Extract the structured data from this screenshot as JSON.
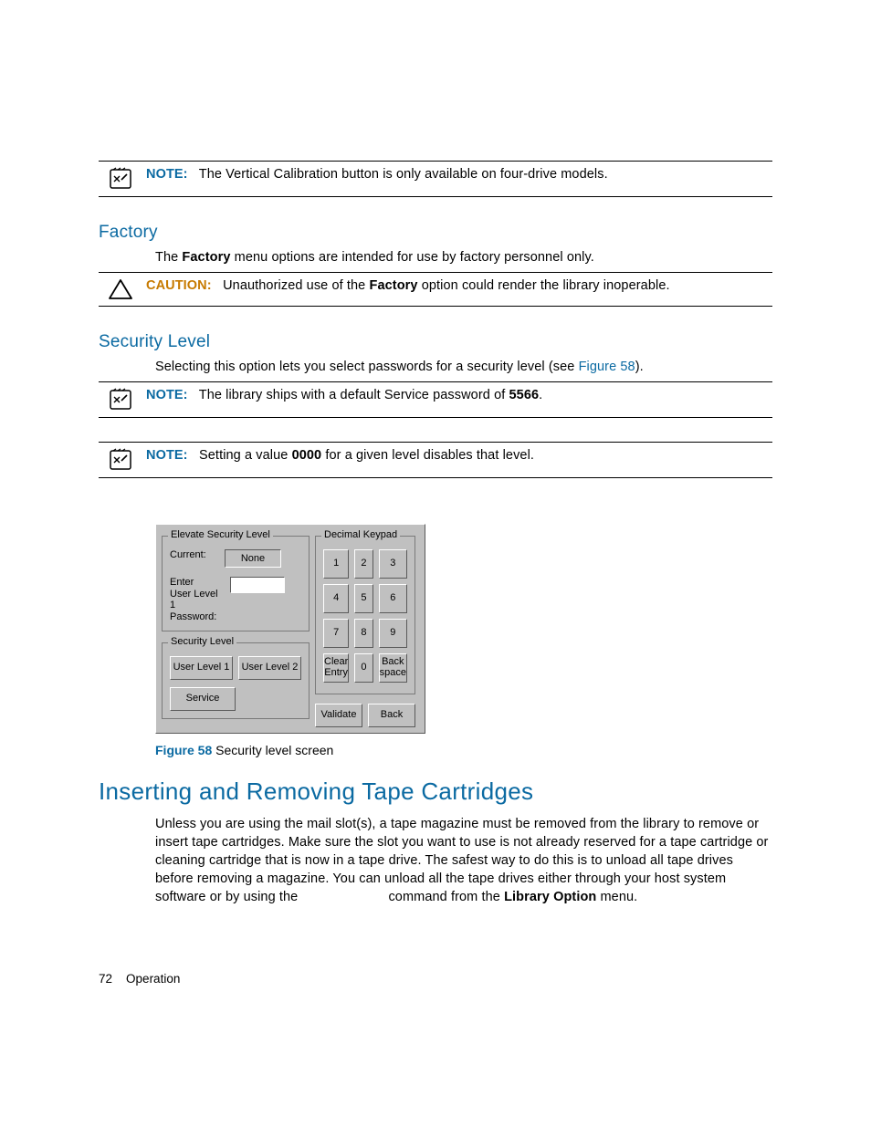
{
  "notes": {
    "n1": {
      "label": "NOTE:",
      "pre": "The Vertical Calibration button is only available on four-drive models.",
      "post": ""
    },
    "n2": {
      "label": "NOTE:",
      "pre": "The library ships with a default Service password of ",
      "bold": "5566",
      "post": "."
    },
    "n3": {
      "label": "NOTE:",
      "pre": "Setting a value ",
      "bold": "0000",
      "post": " for a given level disables that level."
    }
  },
  "caution": {
    "label": "CAUTION:",
    "pre": "Unauthorized use of the ",
    "bold": "Factory",
    "post": " option could render the library inoperable."
  },
  "headings": {
    "factory": "Factory",
    "security": "Security Level",
    "cartridges": "Inserting and Removing Tape Cartridges"
  },
  "body": {
    "factory_pre": "The ",
    "factory_bold": "Factory",
    "factory_post": " menu options are intended for use by factory personnel only.",
    "security_pre": "Selecting this option lets you select passwords for a security level (see ",
    "security_link": "Figure 58",
    "security_post": ").",
    "cart": "Unless you are using the mail slot(s), a tape magazine must be removed from the library to remove or insert tape cartridges. Make sure the slot you want to use is not already reserved for a tape cartridge or cleaning cartridge that is now in a tape drive. The safest way to do this is to unload all tape drives before removing a magazine. You can unload all the tape drives either through your host system software or by using the ",
    "cart_cmdgap": " command from the ",
    "cart_bold": "Library Option",
    "cart_post": " menu."
  },
  "figure": {
    "label": "Figure 58",
    "caption": " Security level screen"
  },
  "footer": {
    "page": "72",
    "section": "Operation"
  },
  "screen": {
    "group_elevate": "Elevate Security Level",
    "group_security": "Security Level",
    "group_keypad": "Decimal Keypad",
    "current_label": "Current:",
    "current_value": "None",
    "pwd_label": "Enter\nUser Level 1\nPassword:",
    "pwd_value": "",
    "btn_user1": "User Level 1",
    "btn_user2": "User Level 2",
    "btn_service": "Service",
    "keys": [
      "1",
      "2",
      "3",
      "4",
      "5",
      "6",
      "7",
      "8",
      "9",
      "Clear\nEntry",
      "0",
      "Back\nspace"
    ],
    "btn_validate": "Validate",
    "btn_back": "Back"
  }
}
